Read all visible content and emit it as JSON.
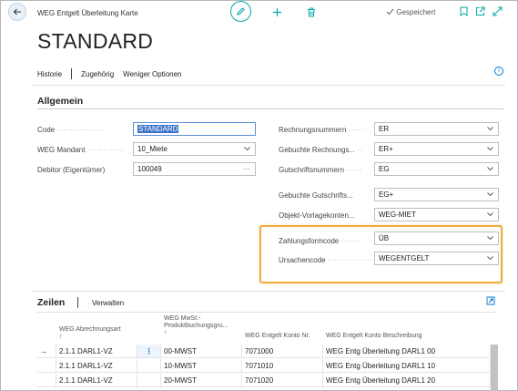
{
  "window": {
    "title": "WEG Entgelt Überleitung Karte",
    "saved_label": "Gespeichert"
  },
  "page": {
    "title": "STANDARD"
  },
  "actions": {
    "history": "Historie",
    "related": "Zugehörig",
    "fewer_options": "Weniger Optionen"
  },
  "section": {
    "general": "Allgemein"
  },
  "fields_left": [
    {
      "label": "Code",
      "value": "STANDARD"
    },
    {
      "label": "WEG Mandant",
      "value": "10_Miete"
    },
    {
      "label": "Debitor (Eigentümer)",
      "value": "100049"
    }
  ],
  "fields_right": [
    {
      "label": "Rechnungsnummern",
      "value": "ER"
    },
    {
      "label": "Gebuchte Rechnungs...",
      "value": "ER+"
    },
    {
      "label": "Gutschriftsnummern",
      "value": "EG"
    },
    {
      "label": "Gebuchte Gutschrifts...",
      "value": "EG+"
    },
    {
      "label": "Objekt-Vorlagekonten...",
      "value": "WEG-MIET"
    },
    {
      "label": "Zahlungsformcode",
      "value": "ÜB"
    },
    {
      "label": "Ursachencode",
      "value": "WEGENTGELT"
    }
  ],
  "lines": {
    "title": "Zeilen",
    "manage": "Verwalten",
    "columns": {
      "type": "WEG Abrechnungsart",
      "vat_line1": "WEG MwSt.-",
      "vat_line2": "Produktbuchungsgru...",
      "account_no": "WEG Entgelt Konto Nr.",
      "account_desc": "WEG Entgelt Konto Beschreibung"
    },
    "sort_arrow": "↑",
    "rows": [
      {
        "type": "2.1.1 DARL1-VZ",
        "vat": "00-MWST",
        "account_no": "7071000",
        "desc": "WEG Entg Überleitung DARL1 00"
      },
      {
        "type": "2.1.1 DARL1-VZ",
        "vat": "10-MWST",
        "account_no": "7071010",
        "desc": "WEG Entg Überleitung DARL1 10"
      },
      {
        "type": "2.1.1 DARL1-VZ",
        "vat": "20-MWST",
        "account_no": "7071020",
        "desc": "WEG Entg Überleitung DARL1 20"
      }
    ],
    "row_marker": "→",
    "row_menu": "⋮"
  },
  "colors": {
    "accent": "#00a8a8",
    "highlight": "#f0a93a",
    "selection": "#3a73c9",
    "link": "#0078d4"
  },
  "icons": {
    "back": "back-arrow-icon",
    "edit": "pencil-icon",
    "new": "plus-icon",
    "delete": "trash-icon",
    "saved": "checkmark-icon",
    "bookmark": "bookmark-icon",
    "open_new": "open-in-new-window-icon",
    "expand": "expand-icon",
    "info": "info-icon"
  }
}
